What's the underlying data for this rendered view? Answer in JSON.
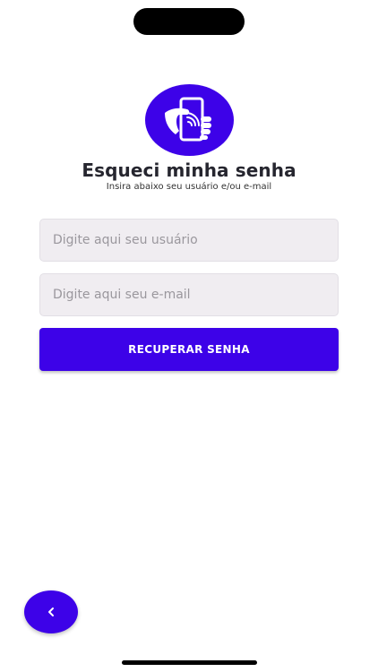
{
  "header": {
    "logo_icon": "phone-in-hand-icon",
    "title": "Esqueci minha senha",
    "subtitle": "Insira abaixo seu usuário e/ou e-mail"
  },
  "form": {
    "username_placeholder": "Digite aqui seu usuário",
    "email_placeholder": "Digite aqui seu e-mail",
    "submit_label": "RECUPERAR SENHA"
  },
  "back_button": {
    "icon": "chevron-left-icon"
  },
  "colors": {
    "accent": "#3d02e8",
    "field_background": "#f0edf1",
    "title_text": "#26262f"
  }
}
